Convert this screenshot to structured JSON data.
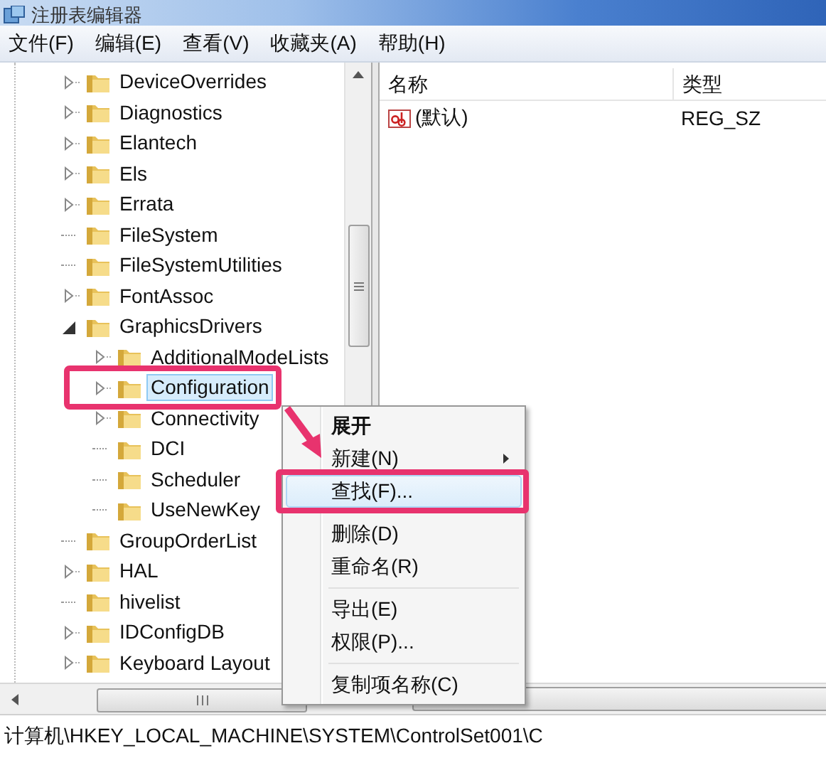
{
  "window": {
    "title": "注册表编辑器"
  },
  "menu": [
    {
      "label": "文件(F)"
    },
    {
      "label": "编辑(E)"
    },
    {
      "label": "查看(V)"
    },
    {
      "label": "收藏夹(A)"
    },
    {
      "label": "帮助(H)"
    }
  ],
  "tree": [
    {
      "kind": "branch",
      "label": "DeviceOverrides",
      "expanded": false,
      "selected": false,
      "annotated": false
    },
    {
      "kind": "branch",
      "label": "Diagnostics",
      "expanded": false,
      "selected": false,
      "annotated": false
    },
    {
      "kind": "branch",
      "label": "Elantech",
      "expanded": false,
      "selected": false,
      "annotated": false
    },
    {
      "kind": "branch",
      "label": "Els",
      "expanded": false,
      "selected": false,
      "annotated": false
    },
    {
      "kind": "branch",
      "label": "Errata",
      "expanded": false,
      "selected": false,
      "annotated": false
    },
    {
      "kind": "leaf",
      "label": "FileSystem",
      "selected": false,
      "annotated": false
    },
    {
      "kind": "leaf",
      "label": "FileSystemUtilities",
      "selected": false,
      "annotated": false
    },
    {
      "kind": "branch",
      "label": "FontAssoc",
      "expanded": false,
      "selected": false,
      "annotated": false
    },
    {
      "kind": "branch",
      "label": "GraphicsDrivers",
      "expanded": true,
      "selected": false,
      "annotated": false,
      "children": [
        {
          "kind": "branch",
          "label": "AdditionalModeLists",
          "expanded": false,
          "selected": false,
          "annotated": false
        },
        {
          "kind": "branch",
          "label": "Configuration",
          "expanded": false,
          "selected": true,
          "annotated": true
        },
        {
          "kind": "branch",
          "label": "Connectivity",
          "expanded": false,
          "selected": false,
          "annotated": false
        },
        {
          "kind": "leaf",
          "label": "DCI",
          "selected": false,
          "annotated": false
        },
        {
          "kind": "leaf",
          "label": "Scheduler",
          "selected": false,
          "annotated": false
        },
        {
          "kind": "leaf",
          "label": "UseNewKey",
          "selected": false,
          "annotated": false
        }
      ]
    },
    {
      "kind": "leaf",
      "label": "GroupOrderList",
      "selected": false,
      "annotated": false
    },
    {
      "kind": "branch",
      "label": "HAL",
      "expanded": false,
      "selected": false,
      "annotated": false
    },
    {
      "kind": "leaf",
      "label": "hivelist",
      "selected": false,
      "annotated": false
    },
    {
      "kind": "branch",
      "label": "IDConfigDB",
      "expanded": false,
      "selected": false,
      "annotated": false
    },
    {
      "kind": "branch",
      "label": "Keyboard Layout",
      "expanded": false,
      "selected": false,
      "annotated": false
    }
  ],
  "values_table": {
    "columns": [
      "名称",
      "类型"
    ],
    "rows": [
      {
        "name": "(默认)",
        "type": "REG_SZ"
      }
    ]
  },
  "context_menu": {
    "items": [
      {
        "kind": "item",
        "label": "展开",
        "default": true,
        "submenu": false,
        "highlighted": false,
        "annotated": false
      },
      {
        "kind": "item",
        "label": "新建(N)",
        "default": false,
        "submenu": true,
        "highlighted": false,
        "annotated": false
      },
      {
        "kind": "item",
        "label": "查找(F)...",
        "default": false,
        "submenu": false,
        "highlighted": true,
        "annotated": true
      },
      {
        "kind": "separator"
      },
      {
        "kind": "item",
        "label": "删除(D)",
        "default": false,
        "submenu": false,
        "highlighted": false,
        "annotated": false
      },
      {
        "kind": "item",
        "label": "重命名(R)",
        "default": false,
        "submenu": false,
        "highlighted": false,
        "annotated": false
      },
      {
        "kind": "separator"
      },
      {
        "kind": "item",
        "label": "导出(E)",
        "default": false,
        "submenu": false,
        "highlighted": false,
        "annotated": false
      },
      {
        "kind": "item",
        "label": "权限(P)...",
        "default": false,
        "submenu": false,
        "highlighted": false,
        "annotated": false
      },
      {
        "kind": "separator"
      },
      {
        "kind": "item",
        "label": "复制项名称(C)",
        "default": false,
        "submenu": false,
        "highlighted": false,
        "annotated": false
      }
    ]
  },
  "status_bar": "计算机\\HKEY_LOCAL_MACHINE\\SYSTEM\\ControlSet001\\C"
}
